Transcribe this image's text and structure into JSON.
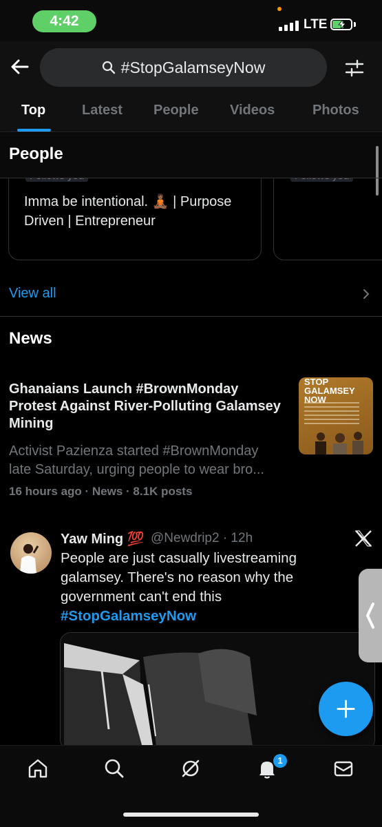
{
  "status_bar": {
    "time": "4:42",
    "network": "LTE"
  },
  "search": {
    "query": "#StopGalamseyNow"
  },
  "tabs": [
    {
      "label": "Top",
      "active": true
    },
    {
      "label": "Latest",
      "active": false
    },
    {
      "label": "People",
      "active": false
    },
    {
      "label": "Videos",
      "active": false
    },
    {
      "label": "Photos",
      "active": false
    }
  ],
  "people_section": {
    "title": "People",
    "cards": [
      {
        "follows_label": "Follows you",
        "bio": "Imma be intentional. 🧘🏾 | Purpose Driven | Entrepreneur"
      },
      {
        "follows_label": "Follows you"
      }
    ],
    "view_all": "View all"
  },
  "news_section": {
    "title": "News",
    "item": {
      "headline": "Ghanaians Launch #BrownMonday Protest Against River-Polluting Galamsey Mining",
      "snippet": "Activist Pazienza started #BrownMonday late Saturday, urging people to wear bro...",
      "meta": "16 hours ago · News · 8.1K posts",
      "thumbnail_text": "STOP GALAMSEY NOW"
    }
  },
  "tweet": {
    "name": "Yaw Ming",
    "name_emoji": "💯",
    "handle": "@Newdrip2",
    "time": "· 12h",
    "body": "People are just casually livestreaming galamsey. There's no reason why the government can't end this",
    "hashtag": "#StopGalamseyNow"
  },
  "bottom_nav": {
    "items": [
      "home-icon",
      "search-icon",
      "grok-icon",
      "notifications-icon",
      "messages-icon"
    ],
    "notification_count": "1"
  },
  "colors": {
    "accent": "#1d9bf0",
    "background": "#000000",
    "secondary_text": "#71767b"
  }
}
